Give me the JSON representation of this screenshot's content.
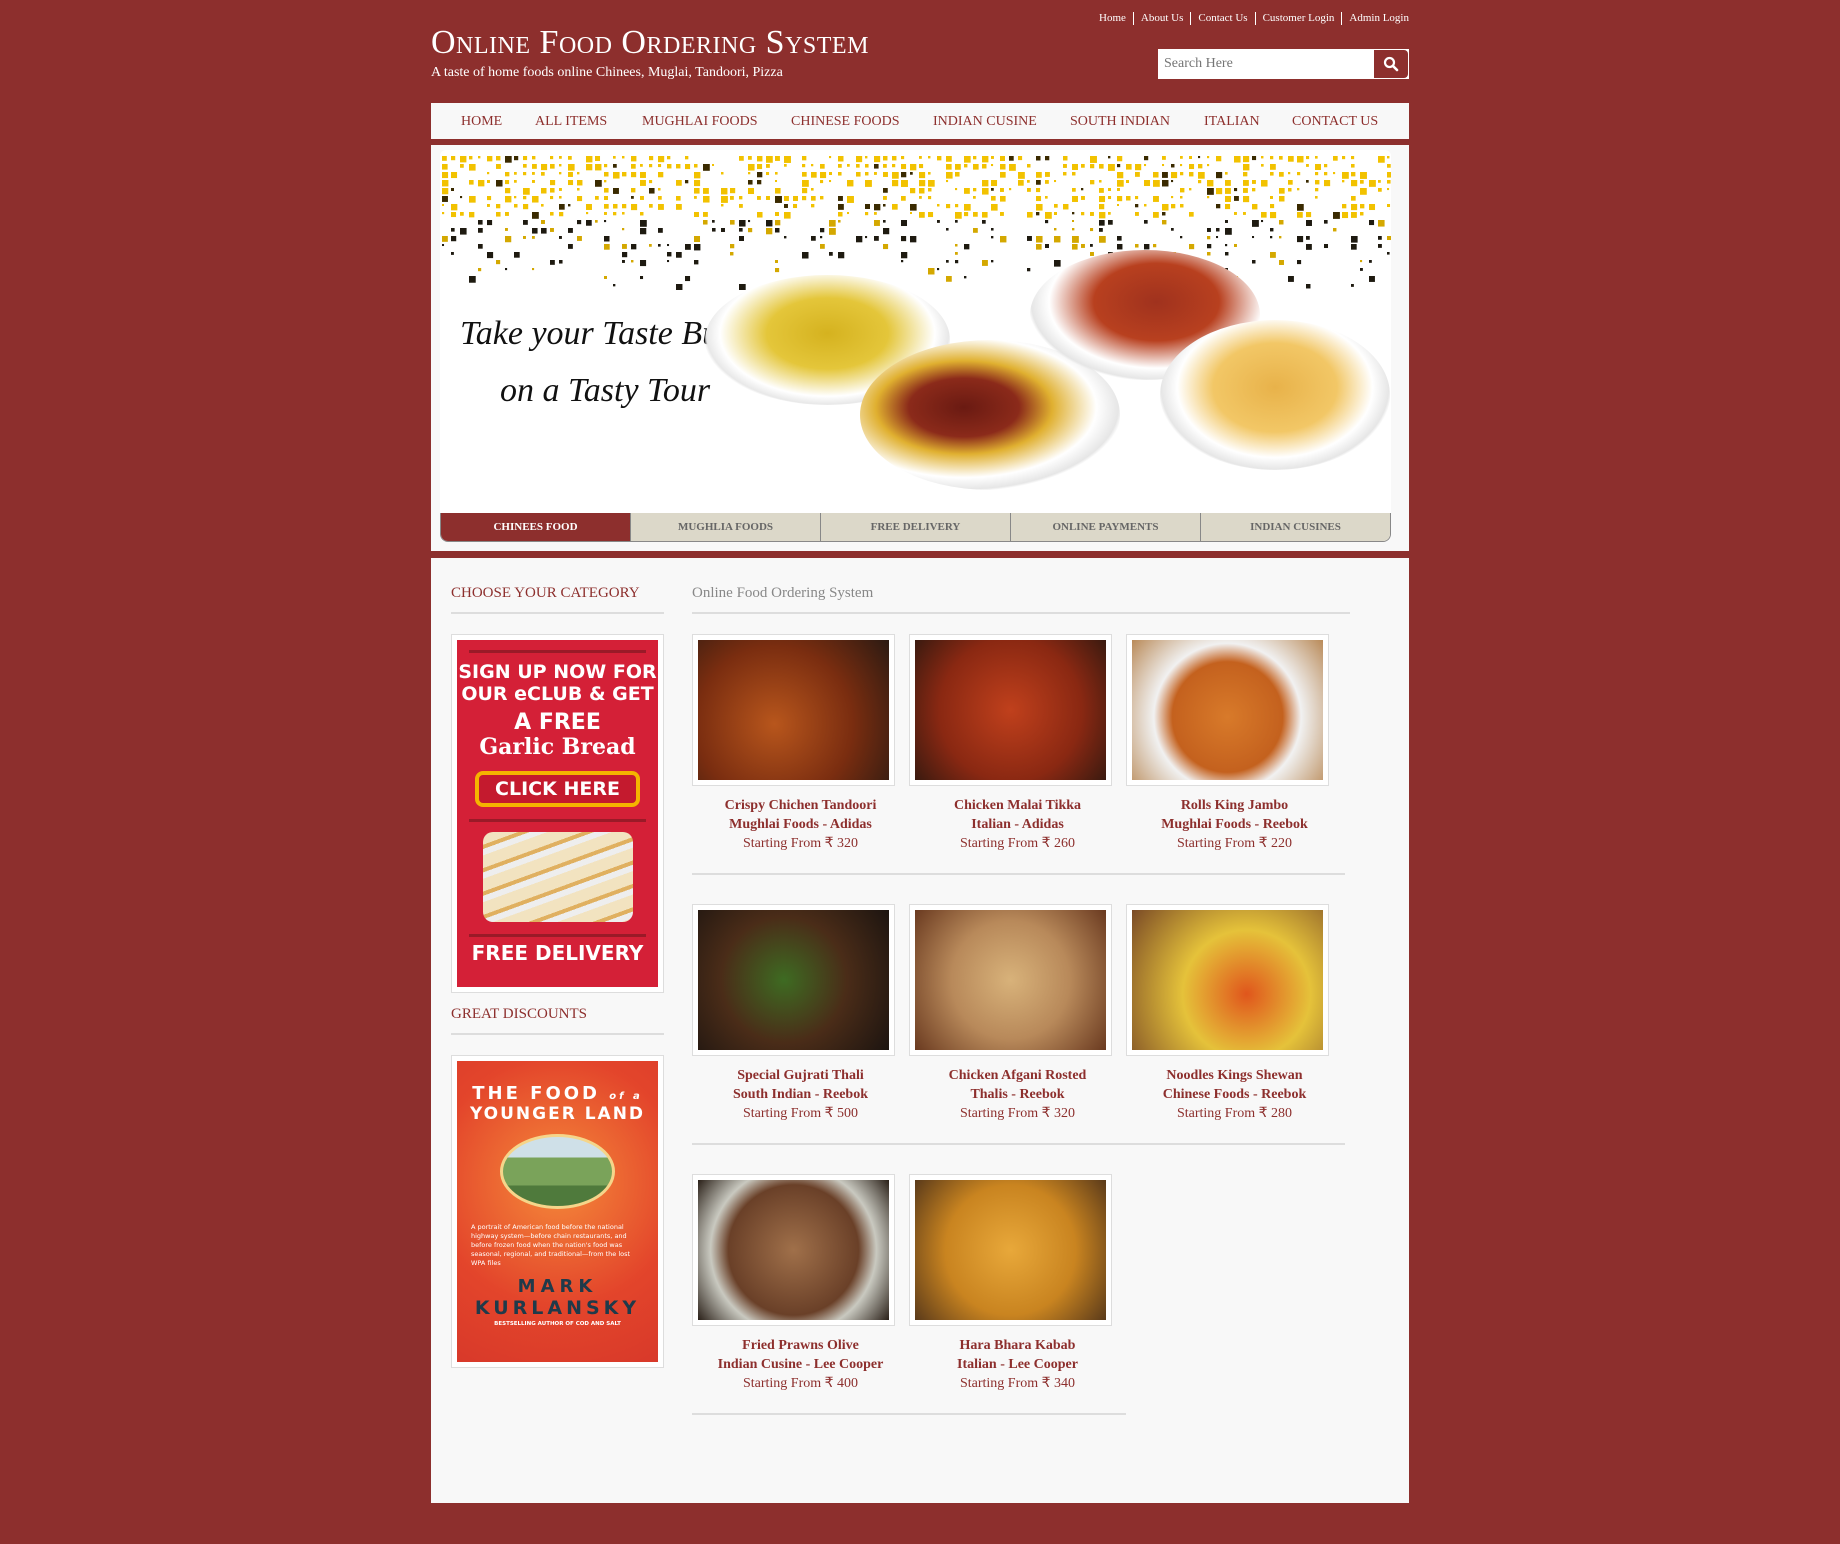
{
  "top_links": [
    "Home",
    "About Us",
    "Contact Us",
    "Customer Login",
    "Admin Login"
  ],
  "header": {
    "title": "Online Food Ordering System",
    "subtitle": "A taste of home foods online Chinees, Muglai, Tandoori, Pizza"
  },
  "search": {
    "placeholder": "Search Here",
    "icon": "search-icon"
  },
  "nav": [
    "HOME",
    "ALL ITEMS",
    "MUGHLAI FOODS",
    "CHINESE FOODS",
    "INDIAN CUSINE",
    "SOUTH INDIAN",
    "ITALIAN",
    "CONTACT US"
  ],
  "banner": {
    "line1": "Take your Taste Buds",
    "line2": "on a Tasty Tour"
  },
  "banner_tabs": [
    "CHINEES FOOD",
    "MUGHLIA FOODS",
    "FREE DELIVERY",
    "ONLINE PAYMENTS",
    "INDIAN CUSINES"
  ],
  "sidebar": {
    "heading1": "CHOOSE YOUR CATEGORY",
    "ad": {
      "l1": "SIGN UP NOW FOR",
      "l2": "OUR eCLUB & GET",
      "l3": "A FREE",
      "l4": "Garlic Bread",
      "button": "CLICK HERE",
      "footer": "FREE DELIVERY"
    },
    "heading2": "GREAT DISCOUNTS",
    "book": {
      "t1": "THE FOOD",
      "t2": "of a",
      "t3": "YOUNGER LAND",
      "blurb": "A portrait of American food before the national highway system—before chain restaurants, and before frozen food when the nation's food was seasonal, regional, and traditional—from the lost WPA files",
      "a1": "MARK",
      "a2": "KURLANSKY",
      "tag": "BESTSELLING AUTHOR OF COD AND SALT"
    }
  },
  "main": {
    "heading": "Online Food Ordering System"
  },
  "products": [
    {
      "name": "Crispy Chichen Tandoori",
      "category": "Mughlai Foods - Adidas",
      "price": "Starting From ₹ 320"
    },
    {
      "name": "Chicken Malai Tikka",
      "category": "Italian - Adidas",
      "price": "Starting From ₹ 260"
    },
    {
      "name": "Rolls King Jambo",
      "category": "Mughlai Foods - Reebok",
      "price": "Starting From ₹ 220"
    },
    {
      "name": "Special Gujrati Thali",
      "category": "South Indian - Reebok",
      "price": "Starting From ₹ 500"
    },
    {
      "name": "Chicken Afgani Rosted",
      "category": "Thalis - Reebok",
      "price": "Starting From ₹ 320"
    },
    {
      "name": "Noodles Kings Shewan",
      "category": "Chinese Foods - Reebok",
      "price": "Starting From ₹ 280"
    },
    {
      "name": "Fried Prawns Olive",
      "category": "Indian Cusine - Lee Cooper",
      "price": "Starting From ₹ 400"
    },
    {
      "name": "Hara Bhara Kabab",
      "category": "Italian - Lee Cooper",
      "price": "Starting From ₹ 340"
    }
  ],
  "colors": {
    "brand": "#8d2f2d",
    "tab_inactive": "#dcd8c9",
    "ad_red": "#d42037"
  }
}
